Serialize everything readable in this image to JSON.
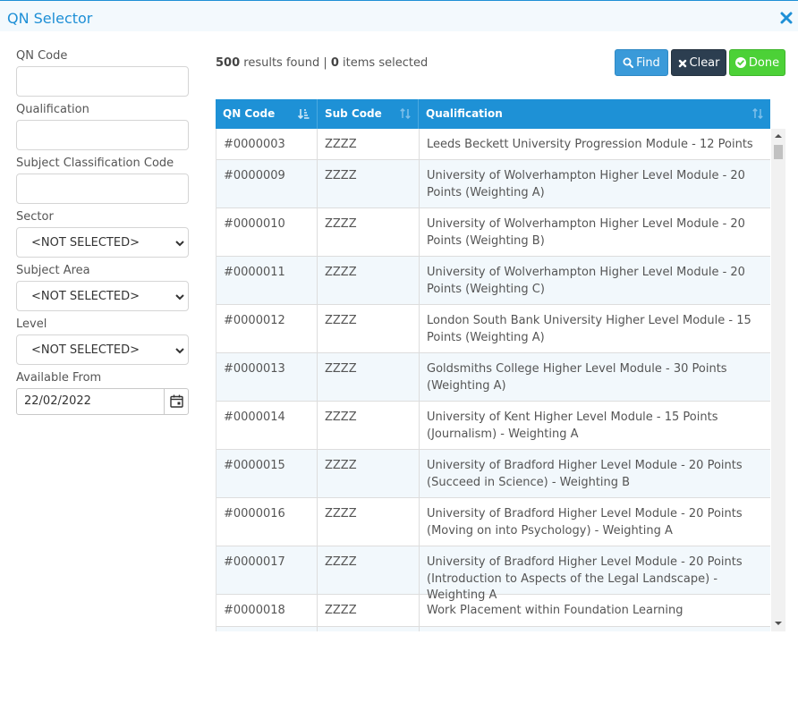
{
  "window": {
    "title": "QN Selector"
  },
  "filters": {
    "qn_code_label": "QN Code",
    "qualification_label": "Qualification",
    "subject_classification_label": "Subject Classification Code",
    "sector_label": "Sector",
    "sector_value": "<NOT SELECTED>",
    "subject_area_label": "Subject Area",
    "subject_area_value": "<NOT SELECTED>",
    "level_label": "Level",
    "level_value": "<NOT SELECTED>",
    "available_from_label": "Available From",
    "available_from_value": "22/02/2022"
  },
  "summary": {
    "results_count": "500",
    "results_text": " results found | ",
    "selected_count": "0",
    "selected_text": " items selected"
  },
  "buttons": {
    "find": "Find",
    "clear": "Clear",
    "done": "Done"
  },
  "colors": {
    "accent": "#1e91d6",
    "find": "#3a9ad9",
    "clear": "#2c3e50",
    "done": "#4cd137"
  },
  "table": {
    "columns": [
      "QN Code",
      "Sub Code",
      "Qualification"
    ],
    "rows": [
      {
        "qn": "#0000003",
        "sub": "ZZZZ",
        "qual": "Leeds Beckett University Progression Module - 12 Points"
      },
      {
        "qn": "#0000009",
        "sub": "ZZZZ",
        "qual": "University of Wolverhampton Higher Level Module - 20 Points (Weighting A)"
      },
      {
        "qn": "#0000010",
        "sub": "ZZZZ",
        "qual": "University of Wolverhampton Higher Level Module - 20 Points (Weighting B)"
      },
      {
        "qn": "#0000011",
        "sub": "ZZZZ",
        "qual": "University of Wolverhampton Higher Level Module - 20 Points (Weighting C)"
      },
      {
        "qn": "#0000012",
        "sub": "ZZZZ",
        "qual": "London South Bank University Higher Level Module - 15 Points (Weighting A)"
      },
      {
        "qn": "#0000013",
        "sub": "ZZZZ",
        "qual": "Goldsmiths College Higher Level Module - 30 Points (Weighting A)"
      },
      {
        "qn": "#0000014",
        "sub": "ZZZZ",
        "qual": "University of Kent Higher Level Module - 15 Points (Journalism) - Weighting A"
      },
      {
        "qn": "#0000015",
        "sub": "ZZZZ",
        "qual": "University of Bradford Higher Level Module - 20 Points (Succeed in Science) - Weighting B"
      },
      {
        "qn": "#0000016",
        "sub": "ZZZZ",
        "qual": "University of Bradford Higher Level Module - 20 Points (Moving on into Psychology) - Weighting A"
      },
      {
        "qn": "#0000017",
        "sub": "ZZZZ",
        "qual": "University of Bradford Higher Level Module - 20 Points (Introduction to Aspects of the Legal Landscape) - Weighting A"
      },
      {
        "qn": "#0000018",
        "sub": "ZZZZ",
        "qual": "Work Placement within Foundation Learning"
      }
    ]
  }
}
